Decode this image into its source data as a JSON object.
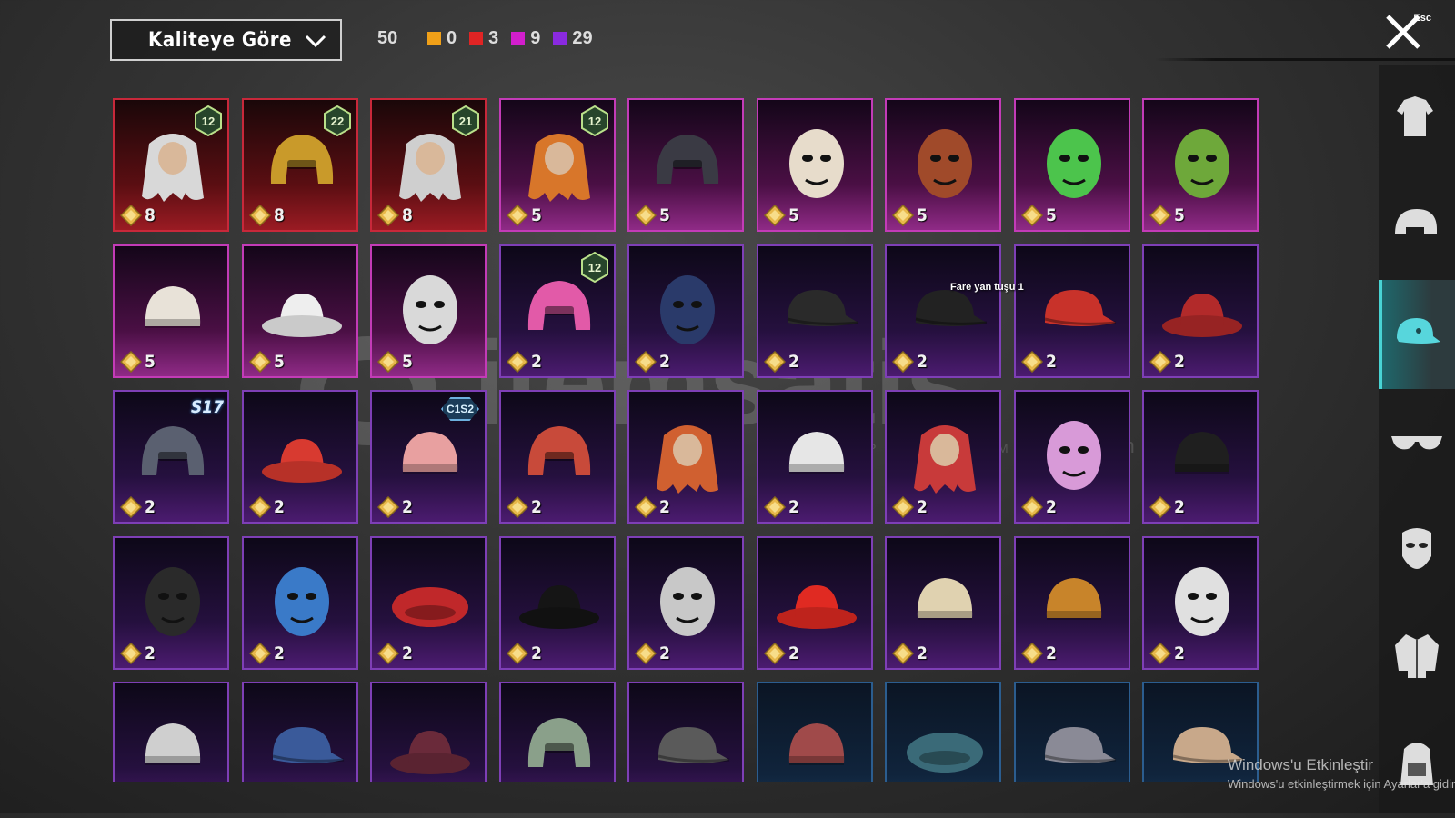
{
  "toolbar": {
    "sort_label": "Kaliteye Göre",
    "total_count": "50",
    "quality_counts": [
      {
        "color": "#f0a018",
        "count": "0"
      },
      {
        "color": "#e02424",
        "count": "3"
      },
      {
        "color": "#d21ecc",
        "count": "9"
      },
      {
        "color": "#8a2ae0",
        "count": "29"
      }
    ],
    "close_hint": "Esc"
  },
  "sidebar": {
    "categories": [
      {
        "icon": "outfit-icon",
        "active": false
      },
      {
        "icon": "helmet-icon",
        "active": false
      },
      {
        "icon": "cap-icon",
        "active": true
      },
      {
        "icon": "glasses-icon",
        "active": false
      },
      {
        "icon": "mask-icon",
        "active": false
      },
      {
        "icon": "jacket-icon",
        "active": false
      },
      {
        "icon": "backpack-icon",
        "active": false
      }
    ]
  },
  "tooltip": "Fare yan tuşu 1",
  "items": [
    {
      "name": "white-hair-bunny-ears",
      "quality": "red",
      "cost": "8",
      "badge": "12",
      "color": "#d8d8d8"
    },
    {
      "name": "golden-pharaoh-helmet",
      "quality": "red",
      "cost": "8",
      "badge": "22",
      "color": "#c99a2a"
    },
    {
      "name": "joker-mask-hair",
      "quality": "red",
      "cost": "8",
      "badge": "21",
      "color": "#cfcfcf"
    },
    {
      "name": "orange-pigtail-hair",
      "quality": "pink",
      "cost": "5",
      "badge": "12",
      "color": "#d8762a"
    },
    {
      "name": "spiked-black-helmet",
      "quality": "pink",
      "cost": "5",
      "badge": "",
      "color": "#3a3a44"
    },
    {
      "name": "bearded-viking-head",
      "quality": "pink",
      "cost": "5",
      "badge": "",
      "color": "#e7dccb"
    },
    {
      "name": "spiked-crown-mask",
      "quality": "pink",
      "cost": "5",
      "badge": "",
      "color": "#a04a2a"
    },
    {
      "name": "green-frog-hat",
      "quality": "pink",
      "cost": "5",
      "badge": "",
      "color": "#4cc44c"
    },
    {
      "name": "frankenstein-mask",
      "quality": "pink",
      "cost": "5",
      "badge": "",
      "color": "#6ea83a"
    },
    {
      "name": "bandana-dreadlocks",
      "quality": "pink",
      "cost": "5",
      "badge": "",
      "color": "#e8e2d8"
    },
    {
      "name": "white-bucket-hat",
      "quality": "pink",
      "cost": "5",
      "badge": "",
      "color": "#eeeeee"
    },
    {
      "name": "skull-ghost-mask",
      "quality": "pink",
      "cost": "5",
      "badge": "",
      "color": "#d9d9d9"
    },
    {
      "name": "bunny-ear-helmet",
      "quality": "purple",
      "cost": "2",
      "badge": "12",
      "color": "#e25aa8"
    },
    {
      "name": "gasmask-helmet",
      "quality": "purple",
      "cost": "2",
      "badge": "",
      "color": "#2a3a6a"
    },
    {
      "name": "black-flat-cap",
      "quality": "purple",
      "cost": "2",
      "badge": "",
      "color": "#2a2a2a"
    },
    {
      "name": "black-crown-cap",
      "quality": "purple",
      "cost": "2",
      "badge": "",
      "color": "#222222"
    },
    {
      "name": "red-gold-cap",
      "quality": "purple",
      "cost": "2",
      "badge": "",
      "color": "#c8322a"
    },
    {
      "name": "denim-bucket-red-hair",
      "quality": "purple",
      "cost": "2",
      "badge": "",
      "color": "#b22a2a"
    },
    {
      "name": "dark-viking-helmet",
      "quality": "purple",
      "cost": "2",
      "badge": "S17",
      "color": "#5a6070"
    },
    {
      "name": "red-fez",
      "quality": "purple",
      "cost": "2",
      "badge": "",
      "color": "#d83a30"
    },
    {
      "name": "striped-beanie",
      "quality": "purple",
      "cost": "2",
      "badge": "C1S2",
      "color": "#e8a0a0"
    },
    {
      "name": "red-racing-helmet",
      "quality": "purple",
      "cost": "2",
      "badge": "",
      "color": "#c84a3a"
    },
    {
      "name": "yellow-helmet-red-hair",
      "quality": "purple",
      "cost": "2",
      "badge": "",
      "color": "#d06030"
    },
    {
      "name": "white-headwrap",
      "quality": "purple",
      "cost": "2",
      "badge": "",
      "color": "#e6e6e6"
    },
    {
      "name": "red-curly-hair",
      "quality": "purple",
      "cost": "2",
      "badge": "",
      "color": "#c83a3a"
    },
    {
      "name": "pink-cat-headphones",
      "quality": "purple",
      "cost": "2",
      "badge": "",
      "color": "#d89ad8"
    },
    {
      "name": "black-beanie",
      "quality": "purple",
      "cost": "2",
      "badge": "",
      "color": "#1f1f1f"
    },
    {
      "name": "black-luchador-mask",
      "quality": "purple",
      "cost": "2",
      "badge": "",
      "color": "#2a2a2a"
    },
    {
      "name": "shark-hat",
      "quality": "purple",
      "cost": "2",
      "badge": "",
      "color": "#3a7ac8"
    },
    {
      "name": "red-beret",
      "quality": "purple",
      "cost": "2",
      "badge": "",
      "color": "#c0282a"
    },
    {
      "name": "black-fedora",
      "quality": "purple",
      "cost": "2",
      "badge": "",
      "color": "#151515"
    },
    {
      "name": "white-shark-hood",
      "quality": "purple",
      "cost": "2",
      "badge": "",
      "color": "#c8c8c8"
    },
    {
      "name": "red-bucket-hat",
      "quality": "purple",
      "cost": "2",
      "badge": "",
      "color": "#e02a22"
    },
    {
      "name": "cupcake-beanie",
      "quality": "purple",
      "cost": "2",
      "badge": "",
      "color": "#e0d2b0"
    },
    {
      "name": "burger-hat",
      "quality": "purple",
      "cost": "2",
      "badge": "",
      "color": "#c8842a"
    },
    {
      "name": "head-mirror-band",
      "quality": "purple",
      "cost": "2",
      "badge": "",
      "color": "#e0e0e0"
    },
    {
      "name": "rope-headband",
      "quality": "purple",
      "cost": "",
      "badge": "",
      "color": "#cfcfcf"
    },
    {
      "name": "navy-sailor-cap",
      "quality": "purple",
      "cost": "",
      "badge": "",
      "color": "#3a5a9a"
    },
    {
      "name": "maroon-fedora",
      "quality": "purple",
      "cost": "",
      "badge": "",
      "color": "#6a2a3a"
    },
    {
      "name": "netted-army-helmet",
      "quality": "purple",
      "cost": "",
      "badge": "",
      "color": "#8aa08a"
    },
    {
      "name": "aviator-goggle-cap",
      "quality": "purple",
      "cost": "",
      "badge": "",
      "color": "#5a5a5a"
    },
    {
      "name": "red-skull-bandana",
      "quality": "blue",
      "cost": "",
      "badge": "",
      "color": "#a04a4a"
    },
    {
      "name": "teal-beret",
      "quality": "blue",
      "cost": "",
      "badge": "",
      "color": "#3a6a78"
    },
    {
      "name": "grey-flat-cap",
      "quality": "blue",
      "cost": "",
      "badge": "",
      "color": "#8a8a96"
    },
    {
      "name": "tan-baseball-cap",
      "quality": "blue",
      "cost": "",
      "badge": "",
      "color": "#c8a88a"
    }
  ],
  "watermark": {
    "brand": "itemsatis",
    "sub": "HESAP / SKIN / ITEM / E-PIN",
    "domain": ".com"
  },
  "os_notice": {
    "title": "Windows'u Etkinleştir",
    "subtitle": "Windows'u etkinleştirmek için Ayarlar'a gidin."
  }
}
